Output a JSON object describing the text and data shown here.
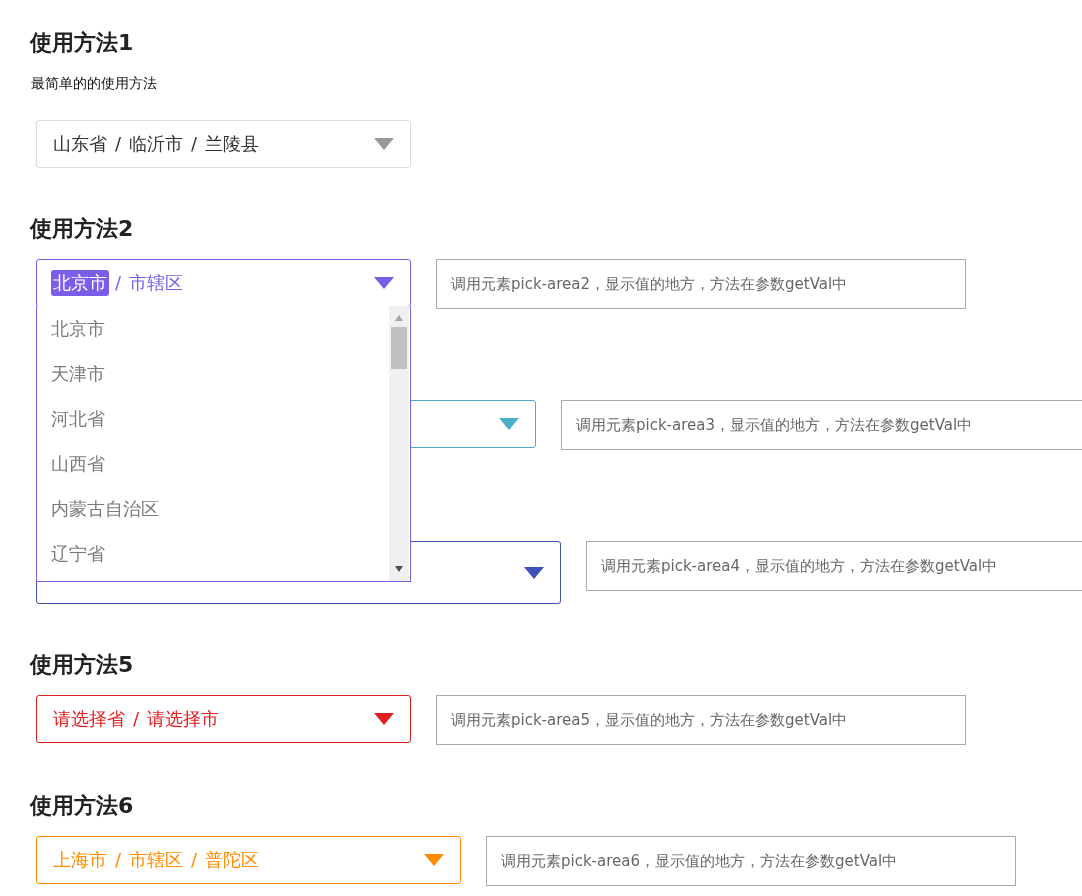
{
  "sections": [
    {
      "heading": "使用方法1",
      "description": "最简单的的使用方法",
      "picker": {
        "kind": "narrow",
        "separator": "/",
        "segments": [
          {
            "text": "山东省",
            "selected": false
          },
          {
            "text": "临沂市",
            "selected": false
          },
          {
            "text": "兰陵县",
            "selected": false
          }
        ],
        "open": false
      }
    },
    {
      "heading": "使用方法2",
      "picker": {
        "kind": "narrow",
        "color": "#7b5ee8",
        "separator": "/",
        "segments": [
          {
            "text": "北京市",
            "selected": true
          },
          {
            "text": "市辖区",
            "selected": false
          }
        ],
        "open": true,
        "options": [
          "北京市",
          "天津市",
          "河北省",
          "山西省",
          "内蒙古自治区",
          "辽宁省"
        ]
      },
      "input": {
        "placeholder": "调用元素pick-area2，显示值的地方，方法在参数getVal中"
      }
    },
    {
      "picker": {
        "kind": "wide",
        "color": "#4bafc7",
        "open": false
      },
      "input": {
        "placeholder": "调用元素pick-area3，显示值的地方，方法在参数getVal中"
      }
    },
    {
      "picker": {
        "kind": "large",
        "color": "#3f51b5",
        "open": false
      },
      "input": {
        "placeholder": "调用元素pick-area4，显示值的地方，方法在参数getVal中"
      }
    },
    {
      "heading": "使用方法5",
      "picker": {
        "kind": "narrow",
        "color": "#e02020",
        "separator": "/",
        "segments": [
          {
            "text": "请选择省",
            "selected": false
          },
          {
            "text": "请选择市",
            "selected": false
          }
        ],
        "open": false
      },
      "input": {
        "placeholder": "调用元素pick-area5，显示值的地方，方法在参数getVal中"
      }
    },
    {
      "heading": "使用方法6",
      "picker": {
        "kind": "medium",
        "color": "#ff8c00",
        "separator": "/",
        "segments": [
          {
            "text": "上海市",
            "selected": false
          },
          {
            "text": "市辖区",
            "selected": false
          },
          {
            "text": "普陀区",
            "selected": false
          }
        ],
        "open": false
      },
      "input": {
        "placeholder": "调用元素pick-area6，显示值的地方，方法在参数getVal中"
      }
    }
  ]
}
